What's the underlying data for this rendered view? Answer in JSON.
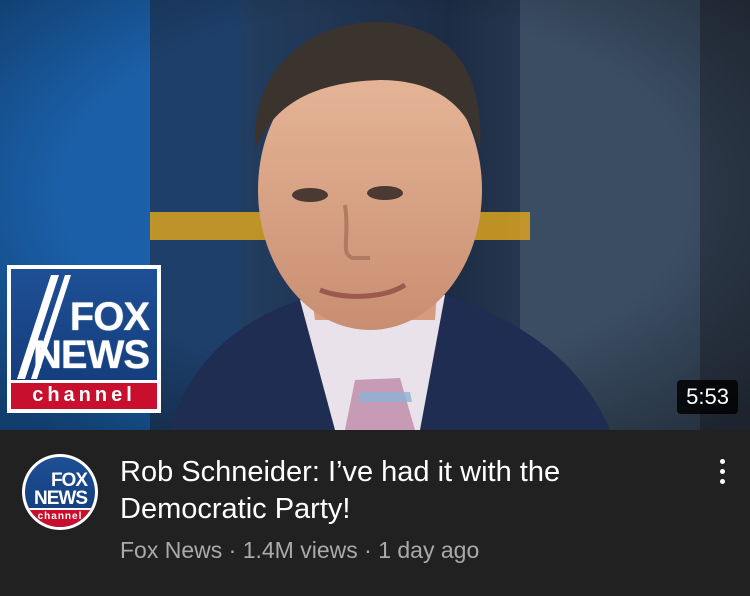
{
  "video": {
    "duration": "5:53",
    "title": "Rob Schneider: I’ve had it with the Democratic Party!",
    "channel": "Fox News",
    "views": "1.4M views",
    "age": "1 day ago",
    "separator": " · "
  },
  "logo": {
    "line1": "FOX",
    "line2": "NEWS",
    "line3": "channel"
  },
  "icons": {
    "menu": "more-vertical-icon"
  },
  "colors": {
    "background": "#212121",
    "secondary_text": "#aaaaaa",
    "fox_blue": "#123a78",
    "fox_red": "#c8102e"
  }
}
